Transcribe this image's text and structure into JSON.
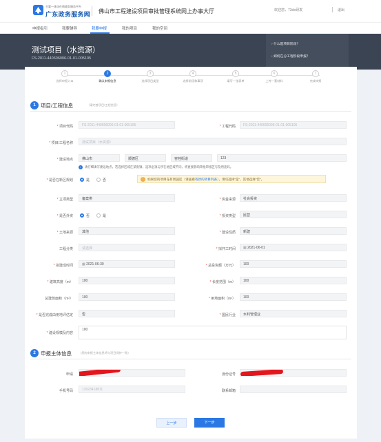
{
  "header": {
    "logo_small": "主要一体化在线政务服务平台",
    "logo_big": "广东政务服务网",
    "system_title": "佛山市工程建设项目审批管理系统网上办事大厅",
    "user_text": "欢迎您，73de研发",
    "logout": "退出"
  },
  "nav": {
    "items": [
      "申报指引",
      "我要辅导",
      "我要申报",
      "我的项目",
      "我的空间"
    ]
  },
  "hero": {
    "title": "测试项目（水资源）",
    "code": "FS-2011-440606006-01-01-005105",
    "links": [
      "什么是项目阶段？",
      "如何在分工程阶段申报？"
    ]
  },
  "steps": [
    {
      "num": "1",
      "label": "选择申报入口"
    },
    {
      "num": "2",
      "label": "确认申报信息"
    },
    {
      "num": "3",
      "label": "选择项目类型"
    },
    {
      "num": "4",
      "label": "选择阶段和事项"
    },
    {
      "num": "5",
      "label": "填写一张表单"
    },
    {
      "num": "6",
      "label": "上传一套材料"
    },
    {
      "num": "7",
      "label": "完成申报"
    }
  ],
  "section1": {
    "num": "1",
    "title": "项目/工程信息",
    "subtitle": "（请完善项目/工程信息）"
  },
  "fields": {
    "project_code_label": "项目代码",
    "project_code_value": "FS-2011-440606006-01-01-005105",
    "project_code2_label": "工程代码",
    "project_code2_value": "FS-2011-440606006-01-01-005105",
    "project_name_label": "项目/工程名称",
    "project_name_value": "测试项目（水资源）",
    "location_label": "建设地点",
    "location_city": "佛山市",
    "location_district": "顺德区",
    "location_town": "容桂街道",
    "location_detail": "123",
    "location_tip": "请仔细填写建设地点，若选择区域在某街镇，选项必须与所在地区域不同，将直接影响审批审核区号及用途码。",
    "park_label": "是否在新区规划",
    "park_yes": "是",
    "park_no": "否",
    "park_notice_a": "如果您的项目在有新园区（请查看",
    "park_notice_link": "有新的项目列表",
    "park_notice_b": "），请勾选择“是”，其他选择“否”。",
    "project_type_label": "立项类型",
    "project_type_value": "备案类",
    "fund_label": "资金来源",
    "fund_value": "社会投资",
    "foreign_label": "是否外资",
    "foreign_yes": "否",
    "foreign_no": "是",
    "invest_type_label": "投资类型",
    "invest_type_value": "民营",
    "land_label": "土地来源",
    "land_value": "其他",
    "construct_label": "建设性质",
    "construct_value": "新建",
    "category_label": "工程分类",
    "category_value": "请选择",
    "start_label": "拟开工时间",
    "start_value": "2021-06-01",
    "finish_label": "拟建成时间",
    "finish_value": "2021-06-30",
    "total_invest_label": "总投资额（万元）",
    "total_invest_value": "100",
    "height_label": "建筑高度（m）",
    "height_value": "100",
    "length_label": "长度范围（m）",
    "length_value": "100",
    "area_label": "总建筑面积（m²）",
    "area_value": "100",
    "land_area_label": "用地面积（m²）",
    "land_area_value": "100",
    "power_label": "是否完成由用地评估定",
    "power_value": "否",
    "industry_label": "国民行业",
    "industry_value": "水利管理业",
    "scale_label": "建设规模及内容",
    "scale_value": "100"
  },
  "section2": {
    "num": "2",
    "title": "申报主体信息",
    "subtitle": "（您的申报主体信息将与项目保持一致）"
  },
  "applicant": {
    "name_label": "申请",
    "id_label": "身份证号",
    "phone_label": "手机号码",
    "phone_value": "13923418811",
    "email_label": "联系邮箱"
  },
  "buttons": {
    "prev": "上一步",
    "next": "下一步"
  },
  "colors": {
    "accent": "#2b78e4",
    "hero_bg": "#3a4452",
    "redaction": "#e3161d"
  }
}
